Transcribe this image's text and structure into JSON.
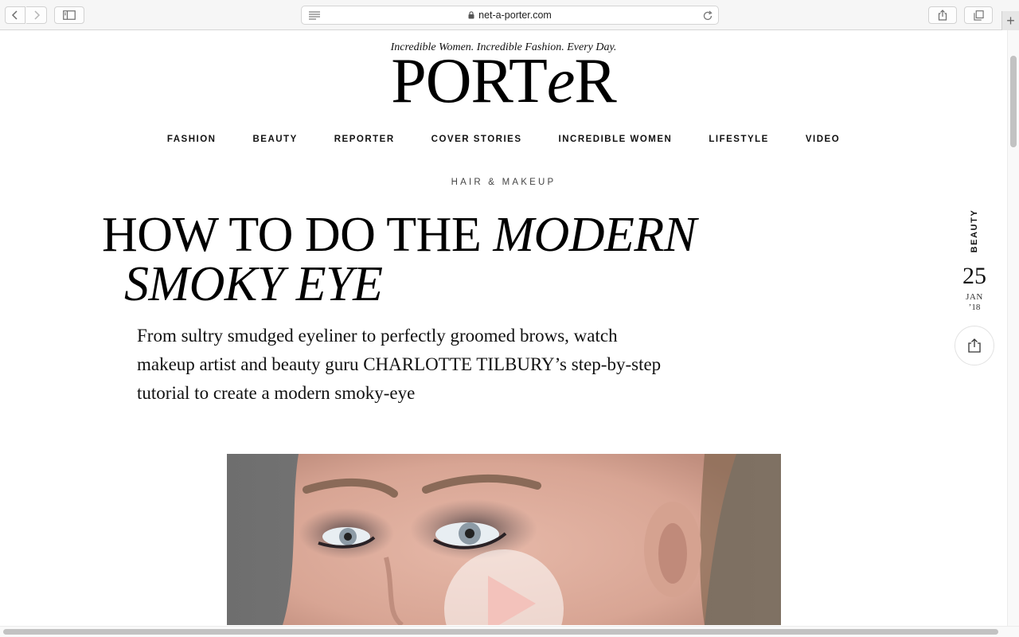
{
  "browser": {
    "url": "net-a-porter.com",
    "icons": [
      "chevron-left-icon",
      "chevron-right-icon",
      "sidebar-icon",
      "reader-icon",
      "lock-icon",
      "reload-icon",
      "share-icon",
      "tabs-icon",
      "plus-icon"
    ],
    "new_tab_label": "+"
  },
  "site": {
    "tagline": "Incredible Women. Incredible Fashion. Every Day.",
    "logo_a": "PORT",
    "logo_e": "e",
    "logo_b": "R",
    "nav": [
      "FASHION",
      "BEAUTY",
      "REPORTER",
      "COVER STORIES",
      "INCREDIBLE WOMEN",
      "LIFESTYLE",
      "VIDEO"
    ]
  },
  "article": {
    "kicker": "HAIR & MAKEUP",
    "headline_roman": "HOW TO DO THE",
    "headline_italic_1": "MODERN",
    "headline_italic_2": "SMOKY EYE",
    "standfirst": "From sultry smudged eyeliner to perfectly groomed brows, watch makeup artist and beauty guru CHARLOTTE TILBURY’s step-by-step tutorial to create a modern smoky-eye"
  },
  "rail": {
    "category": "BEAUTY",
    "day": "25",
    "month": "JAN",
    "year": "’18"
  },
  "colors": {
    "chrome_bg": "#f6f6f6",
    "text": "#111111",
    "video_bg": "#7b7b7b",
    "play_triangle": "#f3c2bb"
  }
}
